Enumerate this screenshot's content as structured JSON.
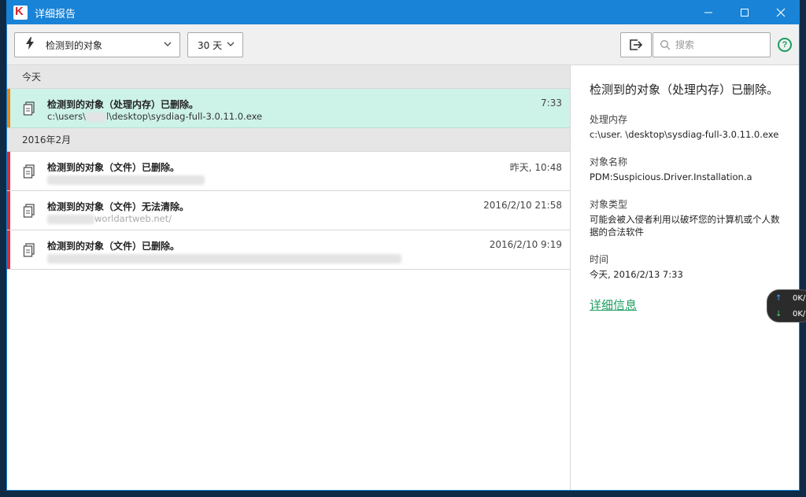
{
  "window": {
    "title": "详细报告",
    "logo_letter": "K",
    "controls": [
      "—",
      "☐",
      "✕"
    ]
  },
  "toolbar": {
    "filter_label": "检测到的对象",
    "period_label": "30 天",
    "search_placeholder": "搜索",
    "help_label": "?"
  },
  "groups": [
    {
      "header": "今天",
      "rows": [
        {
          "title": "检测到的对象（处理内存）已删除。",
          "path_prefix": "c:\\users\\",
          "path_suffix": "l\\desktop\\sysdiag-full-3.0.11.0.exe",
          "time": "7:33",
          "selected": true
        }
      ]
    },
    {
      "header": "2016年2月",
      "rows": [
        {
          "title": "检测到的对象（文件）已删除。",
          "path_prefix": "",
          "path_suffix": "",
          "time": "昨天, 10:48",
          "selected": false
        },
        {
          "title": "检测到的对象（文件）无法清除。",
          "path_prefix": "",
          "path_suffix": "worldartweb.net/",
          "time": "2016/2/10 21:58",
          "selected": false
        },
        {
          "title": "检测到的对象（文件）已删除。",
          "path_prefix": "",
          "path_suffix": "",
          "time": "2016/2/10 9:19",
          "selected": false
        }
      ]
    }
  ],
  "detail": {
    "title": "检测到的对象（处理内存）已删除。",
    "fields": [
      {
        "label": "处理内存",
        "value": "c:\\user.         \\desktop\\sysdiag-full-3.0.11.0.exe"
      },
      {
        "label": "对象名称",
        "value": "PDM:Suspicious.Driver.Installation.a"
      },
      {
        "label": "对象类型",
        "value": "可能会被入侵者利用以破坏您的计算机或个人数据的合法软件"
      },
      {
        "label": "时间",
        "value": "今天, 2016/2/13 7:33"
      }
    ],
    "link": "详细信息"
  },
  "net_widget": {
    "up": "0K/",
    "down": "0K/"
  },
  "colors": {
    "titlebar": "#1883d7",
    "selected_row": "#cdf2e8",
    "accent_green": "#1a9e60",
    "stripe_red": "#d42d3a",
    "stripe_orange": "#e28a17"
  }
}
